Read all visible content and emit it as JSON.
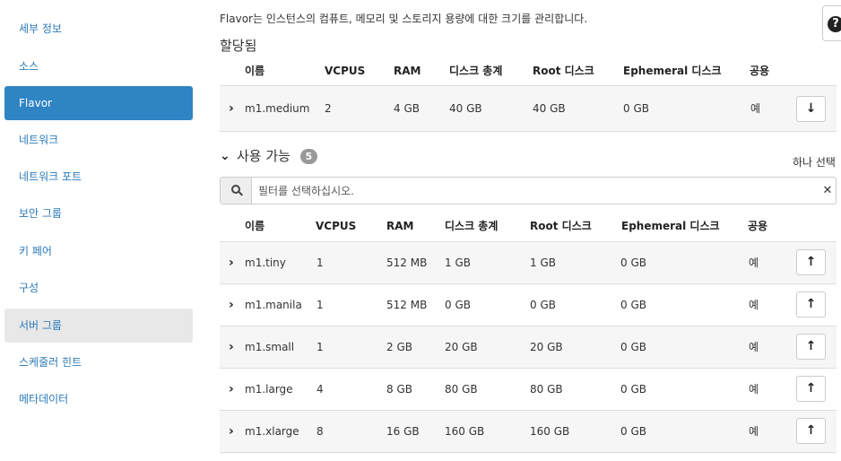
{
  "sidebar": {
    "items": [
      {
        "label": "세부 정보"
      },
      {
        "label": "소스"
      },
      {
        "label": "Flavor"
      },
      {
        "label": "네트워크"
      },
      {
        "label": "네트워크 포트"
      },
      {
        "label": "보안 그룹"
      },
      {
        "label": "키 페어"
      },
      {
        "label": "구성"
      },
      {
        "label": "서버 그룹"
      },
      {
        "label": "스케줄러 힌트"
      },
      {
        "label": "메타데이터"
      }
    ],
    "active_item": "Flavor"
  },
  "main": {
    "description": "Flavor는 인스턴스의 컴퓨트, 메모리 및 스토리지 용량에 대한 크기를 관리합니다.",
    "help_icon": "question-circle-icon",
    "allocated": {
      "title": "할당됨",
      "columns": [
        "이름",
        "VCPUS",
        "RAM",
        "디스크 총계",
        "Root 디스크",
        "Ephemeral 디스크",
        "공용"
      ],
      "rows": [
        {
          "name": "m1.medium",
          "vcpus": "2",
          "ram": "4 GB",
          "total_disk": "40 GB",
          "root_disk": "40 GB",
          "ephemeral": "0 GB",
          "public": "예",
          "action_icon": "arrow-down-icon"
        }
      ]
    },
    "available": {
      "title": "사용 가능",
      "count": "5",
      "select_one": "하나 선택",
      "filter_placeholder": "필터를 선택하십시오.",
      "columns": [
        "이름",
        "VCPUS",
        "RAM",
        "디스크 총계",
        "Root 디스크",
        "Ephemeral 디스크",
        "공용"
      ],
      "rows": [
        {
          "name": "m1.tiny",
          "vcpus": "1",
          "ram": "512 MB",
          "total_disk": "1 GB",
          "root_disk": "1 GB",
          "ephemeral": "0 GB",
          "public": "예",
          "action_icon": "arrow-up-icon"
        },
        {
          "name": "m1.manila",
          "vcpus": "1",
          "ram": "512 MB",
          "total_disk": "0 GB",
          "root_disk": "0 GB",
          "ephemeral": "0 GB",
          "public": "예",
          "action_icon": "arrow-up-icon"
        },
        {
          "name": "m1.small",
          "vcpus": "1",
          "ram": "2 GB",
          "total_disk": "20 GB",
          "root_disk": "20 GB",
          "ephemeral": "0 GB",
          "public": "예",
          "action_icon": "arrow-up-icon"
        },
        {
          "name": "m1.large",
          "vcpus": "4",
          "ram": "8 GB",
          "total_disk": "80 GB",
          "root_disk": "80 GB",
          "ephemeral": "0 GB",
          "public": "예",
          "action_icon": "arrow-up-icon"
        },
        {
          "name": "m1.xlarge",
          "vcpus": "8",
          "ram": "16 GB",
          "total_disk": "160 GB",
          "root_disk": "160 GB",
          "ephemeral": "0 GB",
          "public": "예",
          "action_icon": "arrow-up-icon"
        }
      ]
    }
  },
  "colors": {
    "active_nav": "#2f84c4",
    "link": "#2a7ab8",
    "hover_nav": "#e8e8e8",
    "row_alt": "#f6f6f6"
  }
}
